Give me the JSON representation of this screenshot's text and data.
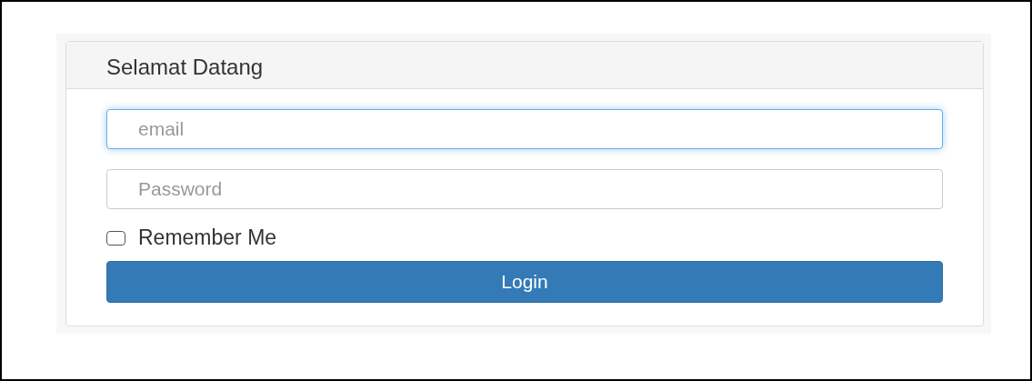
{
  "panel": {
    "title": "Selamat Datang"
  },
  "fields": [
    {
      "placeholder": "email",
      "focused": true
    },
    {
      "placeholder": "Password",
      "focused": false
    }
  ],
  "remember": {
    "label": "Remember Me",
    "checked": false
  },
  "button": {
    "label": "Login"
  }
}
